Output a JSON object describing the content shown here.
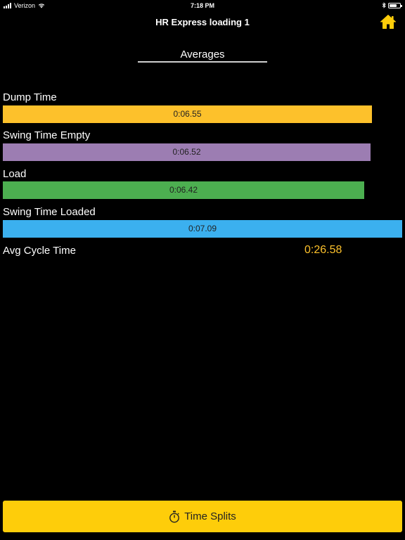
{
  "status_bar": {
    "carrier": "Verizon",
    "time": "7:18 PM",
    "battery_level_percent": 70
  },
  "nav": {
    "title": "HR Express loading 1",
    "home_icon": "home-icon"
  },
  "section": {
    "title": "Averages"
  },
  "metrics": [
    {
      "label": "Dump Time",
      "value": "0:06.55",
      "fraction": 0.924,
      "color": "#fdc12b"
    },
    {
      "label": "Swing Time Empty",
      "value": "0:06.52",
      "fraction": 0.92,
      "color": "#9c7db2"
    },
    {
      "label": "Load",
      "value": "0:06.42",
      "fraction": 0.905,
      "color": "#4caf50"
    },
    {
      "label": "Swing Time Loaded",
      "value": "0:07.09",
      "fraction": 1.0,
      "color": "#3bb0ef"
    }
  ],
  "avg_cycle": {
    "label": "Avg Cycle Time",
    "value": "0:26.58",
    "color": "#fdc12b"
  },
  "bottom_button": {
    "label": "Time Splits",
    "icon": "stopwatch-icon",
    "color": "#fecd0a"
  }
}
